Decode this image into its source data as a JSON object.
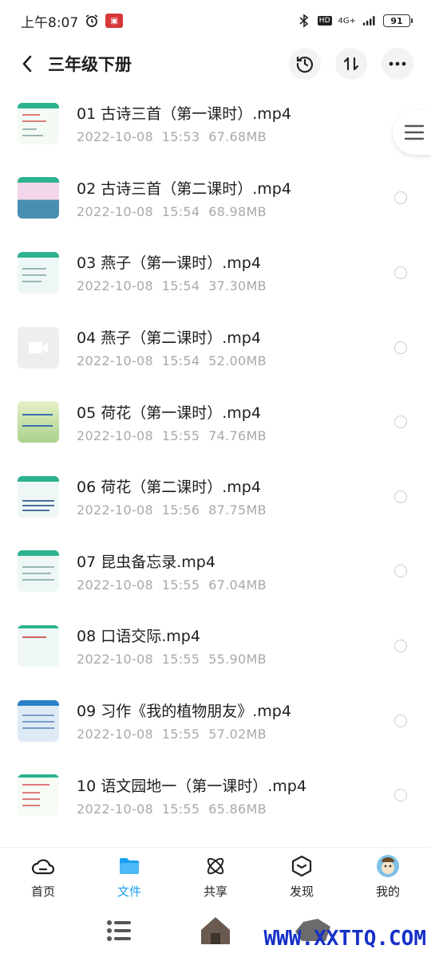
{
  "status_bar": {
    "time": "上午8:07",
    "network": "4G+",
    "hd_badge": "HD",
    "battery": "91"
  },
  "header": {
    "title": "三年级下册"
  },
  "files": [
    {
      "name": "01 古诗三首（第一课时）.mp4",
      "date": "2022-10-08",
      "time": "15:53",
      "size": "67.68MB"
    },
    {
      "name": "02 古诗三首（第二课时）.mp4",
      "date": "2022-10-08",
      "time": "15:54",
      "size": "68.98MB"
    },
    {
      "name": "03 燕子（第一课时）.mp4",
      "date": "2022-10-08",
      "time": "15:54",
      "size": "37.30MB"
    },
    {
      "name": "04 燕子（第二课时）.mp4",
      "date": "2022-10-08",
      "time": "15:54",
      "size": "52.00MB"
    },
    {
      "name": "05 荷花（第一课时）.mp4",
      "date": "2022-10-08",
      "time": "15:55",
      "size": "74.76MB"
    },
    {
      "name": "06 荷花（第二课时）.mp4",
      "date": "2022-10-08",
      "time": "15:56",
      "size": "87.75MB"
    },
    {
      "name": "07 昆虫备忘录.mp4",
      "date": "2022-10-08",
      "time": "15:55",
      "size": "67.04MB"
    },
    {
      "name": "08 口语交际.mp4",
      "date": "2022-10-08",
      "time": "15:55",
      "size": "55.90MB"
    },
    {
      "name": "09 习作《我的植物朋友》.mp4",
      "date": "2022-10-08",
      "time": "15:55",
      "size": "57.02MB"
    },
    {
      "name": "10 语文园地一（第一课时）.mp4",
      "date": "2022-10-08",
      "time": "15:55",
      "size": "65.86MB"
    }
  ],
  "bottom_nav": [
    {
      "label": "首页",
      "icon": "home-cloud-icon"
    },
    {
      "label": "文件",
      "icon": "folder-icon"
    },
    {
      "label": "共享",
      "icon": "share-atom-icon"
    },
    {
      "label": "发现",
      "icon": "discover-box-icon"
    },
    {
      "label": "我的",
      "icon": "avatar-icon"
    }
  ],
  "watermark": "WWW.XXTTQ.COM",
  "colors": {
    "accent": "#1aa0f2",
    "thumb_bar": "#2db28f",
    "meta_text": "#a7a9ad"
  }
}
